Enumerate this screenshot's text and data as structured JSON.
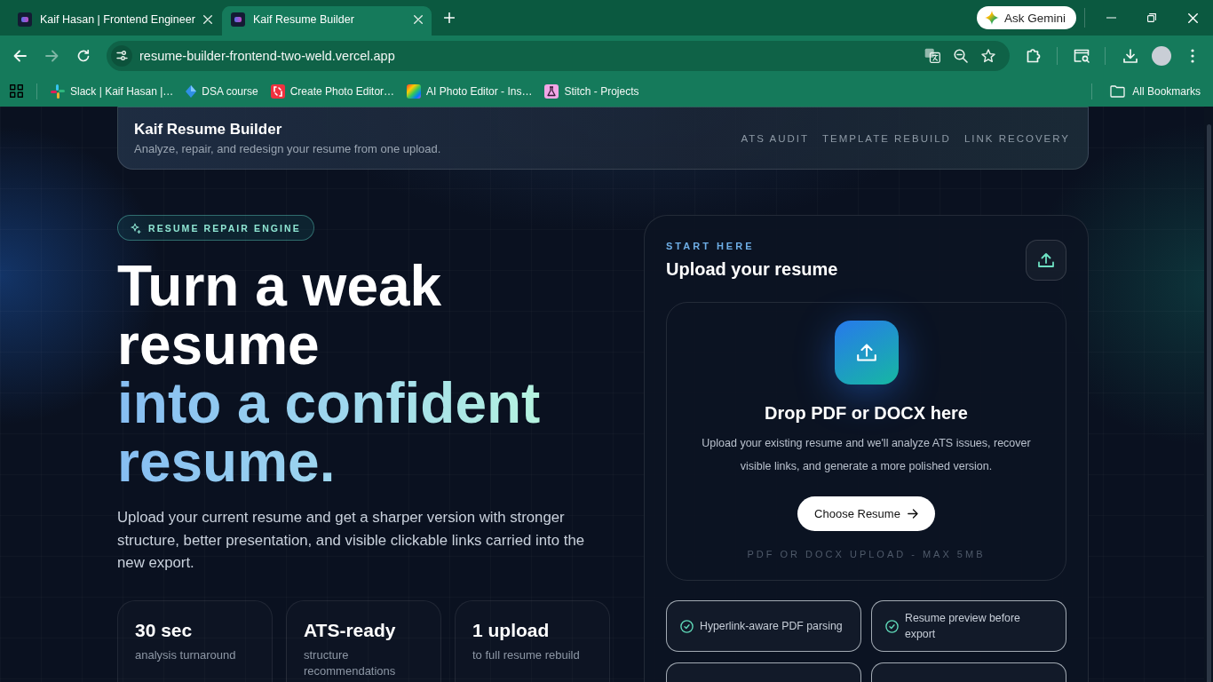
{
  "browser": {
    "tabs": [
      {
        "title": "Kaif Hasan | Frontend Engineer",
        "selected": false
      },
      {
        "title": "Kaif Resume Builder",
        "selected": true
      }
    ],
    "gemini_button": "Ask Gemini",
    "url": "resume-builder-frontend-two-weld.vercel.app",
    "bookmarks": [
      {
        "label": "Slack | Kaif Hasan |…",
        "kind": "pinwheel"
      },
      {
        "label": "DSA course",
        "kind": "diamond"
      },
      {
        "label": "Create Photo Editor…",
        "kind": "bracket"
      },
      {
        "label": "AI Photo Editor - Ins…",
        "kind": "spectrum"
      },
      {
        "label": "Stitch - Projects",
        "kind": "flask"
      }
    ],
    "all_bookmarks": "All Bookmarks"
  },
  "header": {
    "title": "Kaif Resume Builder",
    "subtitle": "Analyze, repair, and redesign your resume from one upload.",
    "nav": [
      "ATS AUDIT",
      "TEMPLATE REBUILD",
      "LINK RECOVERY"
    ]
  },
  "hero": {
    "badge": "RESUME REPAIR ENGINE",
    "heading": [
      {
        "text": "Turn a weak",
        "accent": false
      },
      {
        "text": "resume",
        "accent": false
      },
      {
        "text": "into a confident",
        "accent": true
      },
      {
        "text": "resume.",
        "accent": true
      }
    ],
    "description": "Upload your current resume and get a sharper version with stronger structure, better presentation, and visible clickable links carried into the new export.",
    "stats": [
      {
        "value": "30 sec",
        "label": "analysis turnaround"
      },
      {
        "value": "ATS-ready",
        "label": "structure recommendations"
      },
      {
        "value": "1 upload",
        "label": "to full resume rebuild"
      }
    ]
  },
  "upload_panel": {
    "eyebrow": "START HERE",
    "title": "Upload your resume",
    "dropzone": {
      "title": "Drop PDF or DOCX here",
      "description": "Upload your existing resume and we'll analyze ATS issues, recover visible links, and generate a more polished version.",
      "button": "Choose Resume",
      "note": "PDF OR DOCX UPLOAD - MAX 5MB"
    },
    "features": [
      {
        "kind": "full",
        "text": "Hyperlink-aware PDF parsing"
      },
      {
        "kind": "full",
        "text": "Resume preview before export"
      },
      {
        "kind": "cut"
      },
      {
        "kind": "cut"
      }
    ]
  }
}
